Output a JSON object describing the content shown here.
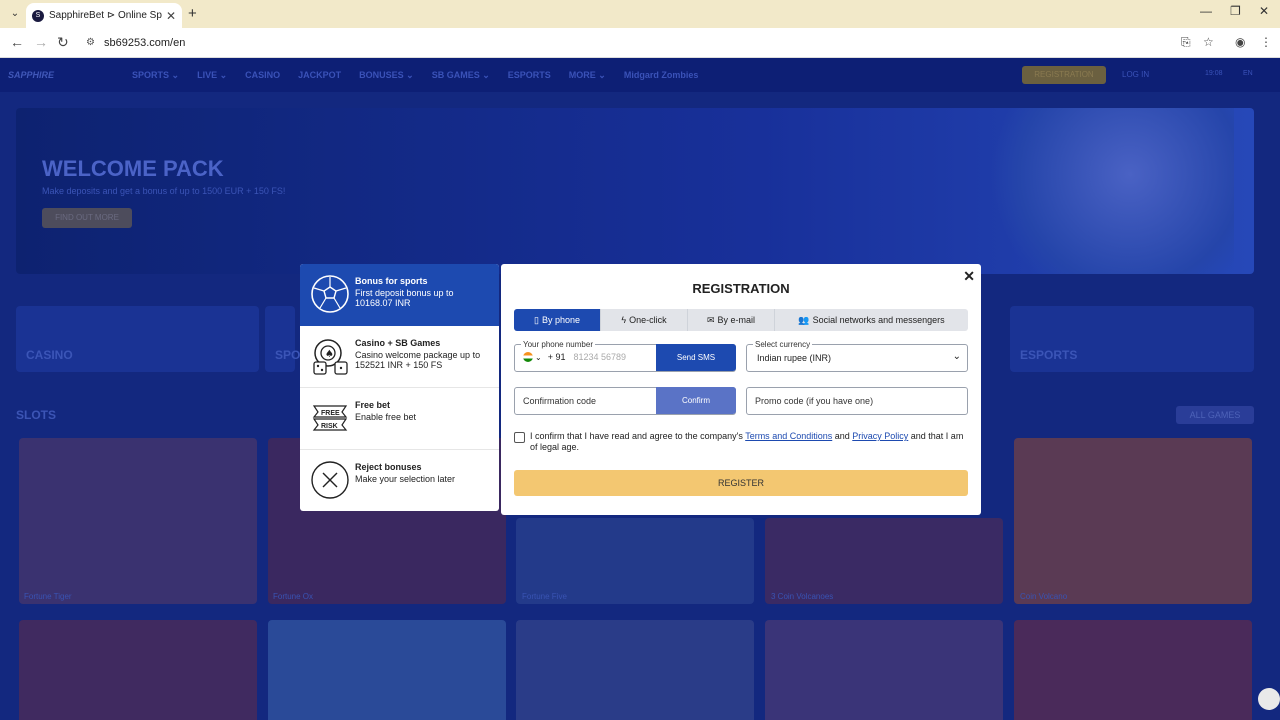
{
  "browser": {
    "tab_title": "SapphireBet ⊳ Online Sports Be",
    "url": "sb69253.com/en"
  },
  "site": {
    "nav": [
      "SPORTS ⌄",
      "LIVE ⌄",
      "CASINO",
      "JACKPOT",
      "BONUSES ⌄",
      "SB GAMES ⌄",
      "ESPORTS",
      "MORE ⌄",
      "Midgard Zombies"
    ],
    "registration": "REGISTRATION",
    "login": "LOG IN",
    "time": "19:08",
    "lang": "EN",
    "hero_title": "WELCOME PACK",
    "hero_sub": "Make deposits and get a bonus of up to 1500 EUR + 150 FS!",
    "hero_btn": "FIND OUT MORE",
    "cats": [
      "CASINO",
      "SPO",
      "ESPORTS"
    ],
    "slots_title": "SLOTS",
    "all_games": "ALL GAMES",
    "games": [
      "Fortune Tiger",
      "Fortune Ox",
      "Fortune Five",
      "3 Coin Volcanoes",
      "Coin Volcano"
    ]
  },
  "bonuses": [
    {
      "title": "Bonus for sports",
      "desc": "First deposit bonus up to 10168.07 INR",
      "icon": "soccer-ball-icon"
    },
    {
      "title": "Casino + SB Games",
      "desc": "Casino welcome package up to 152521 INR + 150 FS",
      "icon": "casino-chip-icon"
    },
    {
      "title": "Free bet",
      "desc": "Enable free bet",
      "icon": "free-bet-icon"
    },
    {
      "title": "Reject bonuses",
      "desc": "Make your selection later",
      "icon": "reject-icon"
    }
  ],
  "registration": {
    "title": "REGISTRATION",
    "tabs": [
      "By phone",
      "One-click",
      "By e-mail",
      "Social networks and messengers"
    ],
    "phone_label": "Your phone number",
    "phone_code": "+ 91",
    "phone_placeholder": "81234 56789",
    "send_sms": "Send SMS",
    "currency_label": "Select currency",
    "currency_value": "Indian rupee (INR)",
    "confirmation_placeholder": "Confirmation code",
    "confirm": "Confirm",
    "promo_placeholder": "Promo code (if you have one)",
    "terms_pre": "I confirm that I have read and agree to the company's ",
    "terms_link": "Terms and Conditions",
    "terms_mid": " and ",
    "privacy_link": "Privacy Policy",
    "terms_post": " and that I am of legal age.",
    "register": "REGISTER"
  }
}
